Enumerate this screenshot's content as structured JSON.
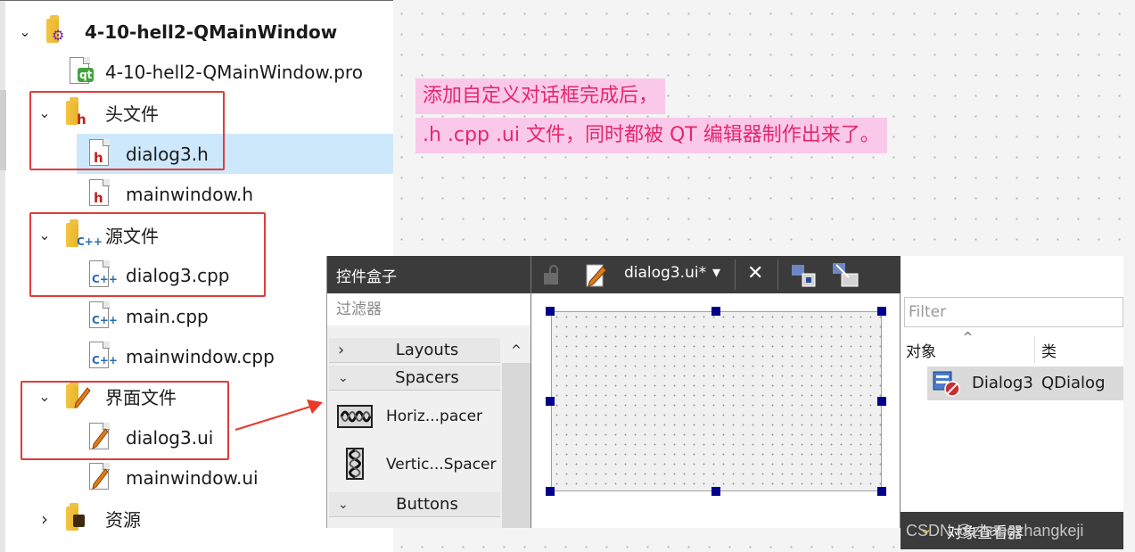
{
  "tree": {
    "project": {
      "label": "4-10-hell2-QMainWindow",
      "expand": "⌄"
    },
    "pro_file": {
      "label": "4-10-hell2-QMainWindow.pro",
      "glyph": "qt"
    },
    "headers": {
      "label": "头文件",
      "glyph": "h",
      "expand": "⌄"
    },
    "dialog3_h": {
      "label": "dialog3.h",
      "glyph": "h"
    },
    "mainwindow_h": {
      "label": "mainwindow.h",
      "glyph": "h"
    },
    "sources": {
      "label": "源文件",
      "glyph": "C++",
      "expand": "⌄"
    },
    "dialog3_cpp": {
      "label": "dialog3.cpp",
      "glyph": "C++"
    },
    "main_cpp": {
      "label": "main.cpp",
      "glyph": "C++"
    },
    "mainwindow_cpp": {
      "label": "mainwindow.cpp",
      "glyph": "C++"
    },
    "forms": {
      "label": "界面文件",
      "expand": "⌄"
    },
    "dialog3_ui": {
      "label": "dialog3.ui"
    },
    "mainwindow_ui": {
      "label": "mainwindow.ui"
    },
    "resources": {
      "label": "资源",
      "expand": "›"
    }
  },
  "callout": {
    "line1": "添加自定义对话框完成后，",
    "line2": ".h  .cpp  .ui  文件，同时都被 QT 编辑器制作出来了。"
  },
  "widget_box": {
    "title": "控件盒子",
    "filter_placeholder": "过滤器",
    "categories": [
      {
        "label": "Layouts",
        "chevron": "›"
      },
      {
        "label": "Spacers",
        "chevron": "⌄"
      },
      {
        "label": "Buttons",
        "chevron": "⌄"
      }
    ],
    "items": [
      {
        "label": "Horiz...pacer",
        "icon": "horizontal-spacer-icon"
      },
      {
        "label": "Vertic...Spacer",
        "icon": "vertical-spacer-icon"
      }
    ],
    "scroll_up": "^"
  },
  "editor": {
    "file_label": "dialog3.ui*",
    "dropdown": "▾",
    "close": "✕"
  },
  "object_inspector": {
    "title": "对象查看器",
    "chevron": "⌄",
    "filter_placeholder": "Filter",
    "col_object": "对象",
    "col_class": "类",
    "sort_indicator": "^",
    "rows": [
      {
        "object": "Dialog3",
        "class": "QDialog"
      }
    ]
  },
  "colors": {
    "highlight_red": "#e03c3c",
    "callout_bg": "#fac9e9",
    "callout_text": "#e6266c",
    "selection": "#cde8fb",
    "designer_bar": "#3b3b3b"
  },
  "watermark": "CSDN @zhangzhangkeji"
}
